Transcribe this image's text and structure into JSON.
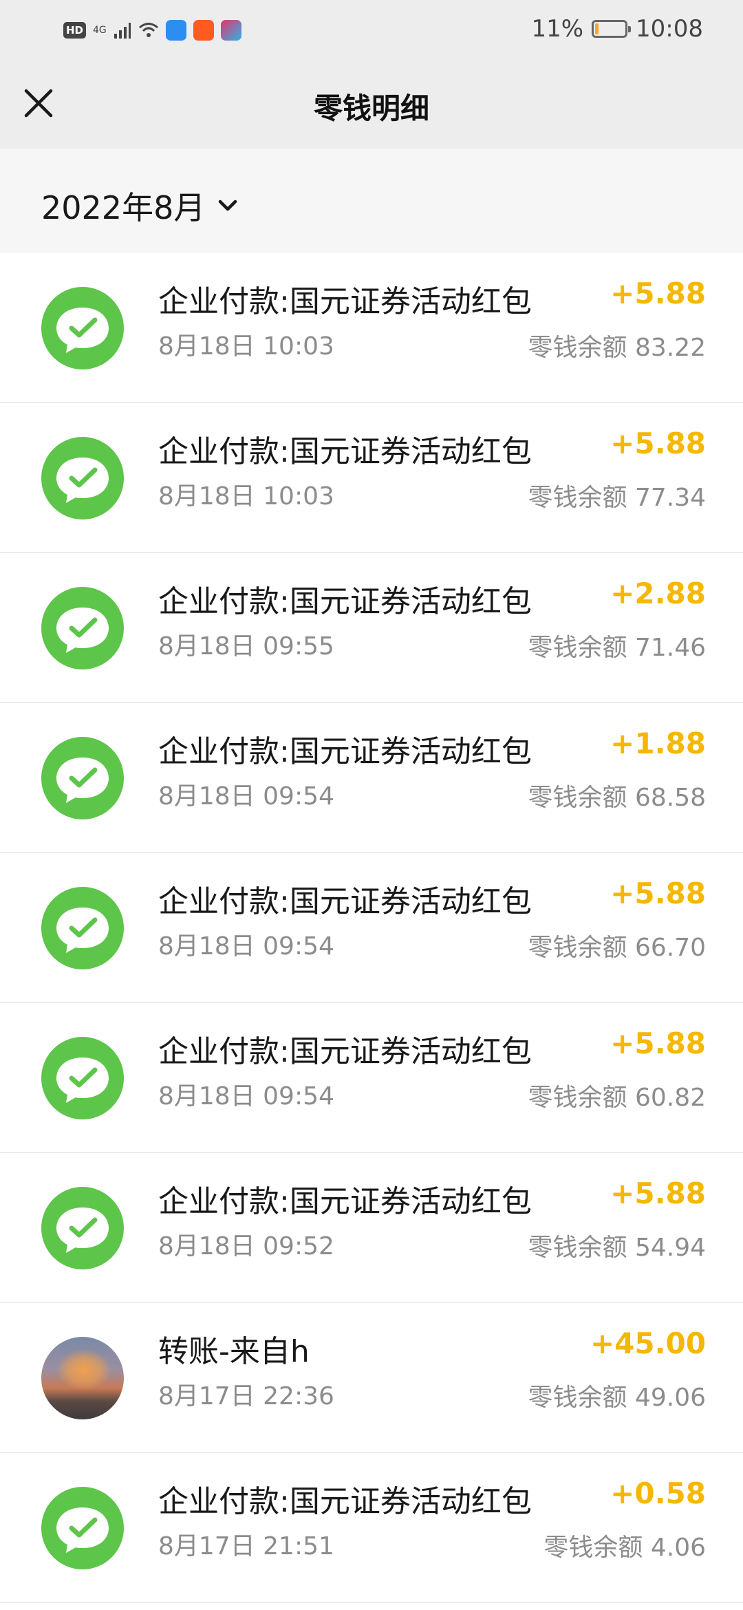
{
  "status_bar": {
    "hd": "HD",
    "network": "4G",
    "battery_percent": "11%",
    "battery_level": 0.11,
    "time": "10:08",
    "battery_color": "#f7a23a"
  },
  "nav": {
    "title": "零钱明细",
    "close_icon": "close-icon"
  },
  "filter": {
    "month": "2022年8月",
    "dropdown_icon": "chevron-down-icon"
  },
  "colors": {
    "amount": "#f5b700",
    "wechat_green": "#5dc54a",
    "secondary_text": "#8c8c8c"
  },
  "transactions": [
    {
      "title": "企业付款:国元证券活动红包",
      "time": "8月18日 10:03",
      "amount": "+5.88",
      "balance_label": "零钱余额",
      "balance": "83.22",
      "avatar": "wechat-pay-icon"
    },
    {
      "title": "企业付款:国元证券活动红包",
      "time": "8月18日 10:03",
      "amount": "+5.88",
      "balance_label": "零钱余额",
      "balance": "77.34",
      "avatar": "wechat-pay-icon"
    },
    {
      "title": "企业付款:国元证券活动红包",
      "time": "8月18日 09:55",
      "amount": "+2.88",
      "balance_label": "零钱余额",
      "balance": "71.46",
      "avatar": "wechat-pay-icon"
    },
    {
      "title": "企业付款:国元证券活动红包",
      "time": "8月18日 09:54",
      "amount": "+1.88",
      "balance_label": "零钱余额",
      "balance": "68.58",
      "avatar": "wechat-pay-icon"
    },
    {
      "title": "企业付款:国元证券活动红包",
      "time": "8月18日 09:54",
      "amount": "+5.88",
      "balance_label": "零钱余额",
      "balance": "66.70",
      "avatar": "wechat-pay-icon"
    },
    {
      "title": "企业付款:国元证券活动红包",
      "time": "8月18日 09:54",
      "amount": "+5.88",
      "balance_label": "零钱余额",
      "balance": "60.82",
      "avatar": "wechat-pay-icon"
    },
    {
      "title": "企业付款:国元证券活动红包",
      "time": "8月18日 09:52",
      "amount": "+5.88",
      "balance_label": "零钱余额",
      "balance": "54.94",
      "avatar": "wechat-pay-icon"
    },
    {
      "title": "转账-来自h",
      "time": "8月17日 22:36",
      "amount": "+45.00",
      "balance_label": "零钱余额",
      "balance": "49.06",
      "avatar": "user-photo"
    },
    {
      "title": "企业付款:国元证券活动红包",
      "time": "8月17日 21:51",
      "amount": "+0.58",
      "balance_label": "零钱余额",
      "balance": "4.06",
      "avatar": "wechat-pay-icon"
    }
  ]
}
